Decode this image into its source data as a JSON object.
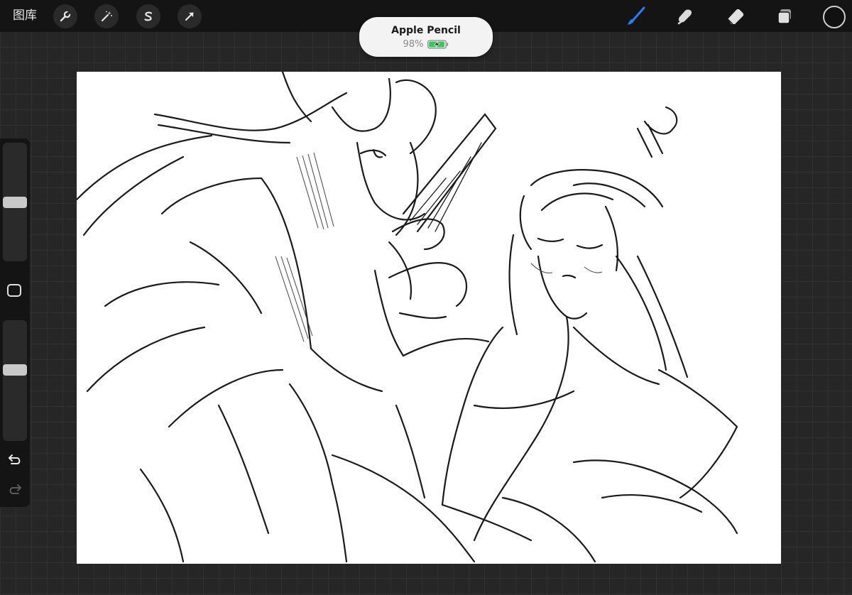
{
  "topbar": {
    "gallery_label": "图库",
    "left_tools": [
      {
        "name": "actions",
        "icon": "wrench-icon"
      },
      {
        "name": "adjustments",
        "icon": "magic-wand-icon"
      },
      {
        "name": "selection",
        "icon": "selection-s-icon"
      },
      {
        "name": "transform",
        "icon": "arrow-cursor-icon"
      }
    ],
    "right_tools": [
      {
        "name": "brush",
        "icon": "brush-icon",
        "active": true
      },
      {
        "name": "smudge",
        "icon": "smudge-icon"
      },
      {
        "name": "eraser",
        "icon": "eraser-icon"
      },
      {
        "name": "layers",
        "icon": "layers-icon"
      }
    ],
    "accent_color": "#2f7bf5",
    "current_color": "#111111"
  },
  "pencil_popup": {
    "device_name": "Apple Pencil",
    "battery_percent_label": "98%",
    "battery_level": 0.98,
    "battery_color": "#34c759"
  },
  "sidebar": {
    "brush_size_level": 0.5,
    "opacity_level": 0.6,
    "undo_icon": "undo-icon",
    "redo_icon": "redo-icon"
  }
}
